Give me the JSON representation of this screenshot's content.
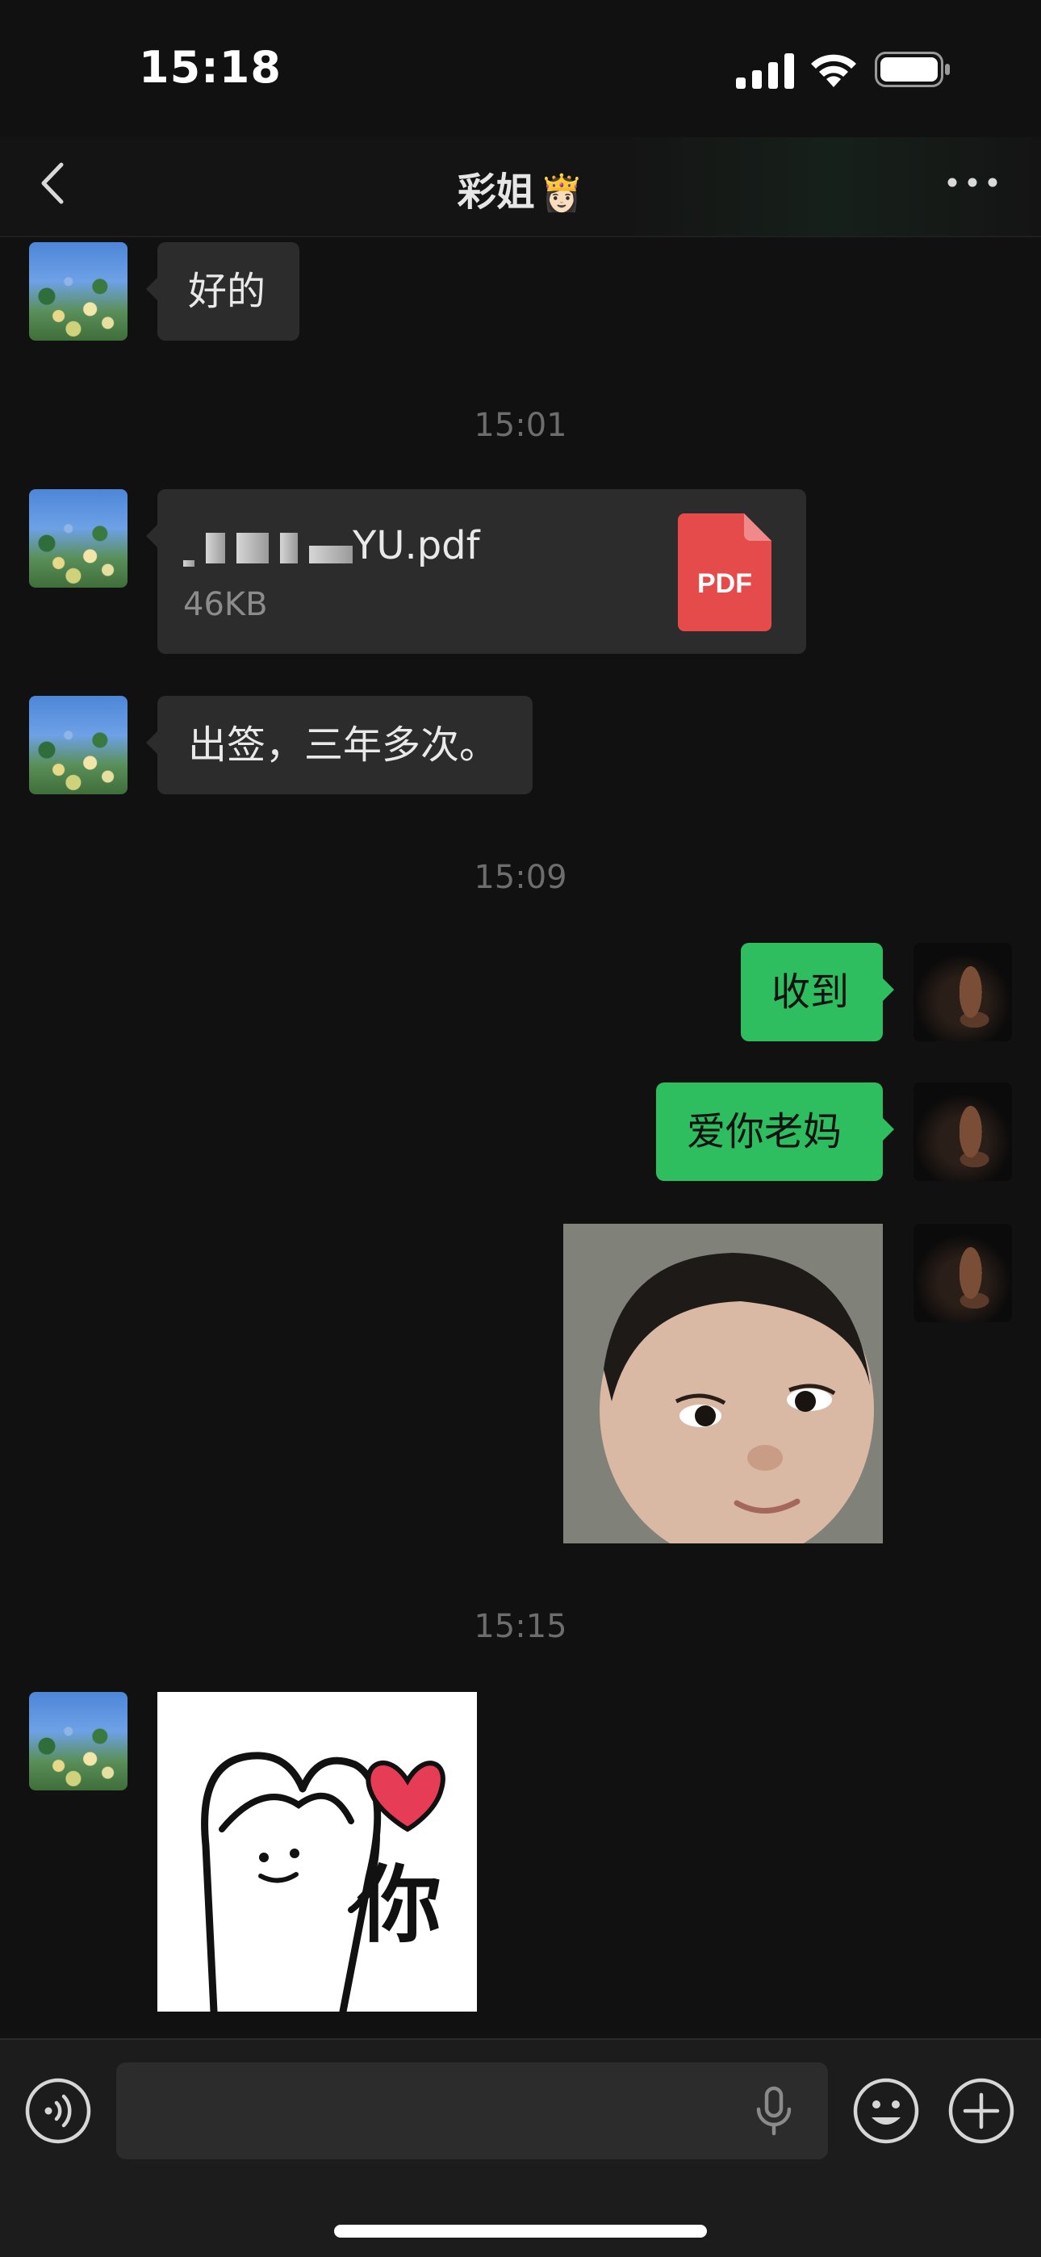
{
  "status_bar": {
    "time": "15:18"
  },
  "nav": {
    "title": "彩姐",
    "title_emoji": "👸🏻"
  },
  "messages": [
    {
      "type": "text",
      "direction": "incoming",
      "text": "好的"
    },
    {
      "type": "timestamp",
      "text": "15:01"
    },
    {
      "type": "file",
      "direction": "incoming",
      "file_name": "YU.pdf",
      "file_size": "46KB",
      "file_type_label": "PDF"
    },
    {
      "type": "text",
      "direction": "incoming",
      "text": "出签，三年多次。"
    },
    {
      "type": "timestamp",
      "text": "15:09"
    },
    {
      "type": "text",
      "direction": "outgoing",
      "text": "收到"
    },
    {
      "type": "text",
      "direction": "outgoing",
      "text": "爱你老妈"
    },
    {
      "type": "image",
      "direction": "outgoing"
    },
    {
      "type": "timestamp",
      "text": "15:15"
    },
    {
      "type": "sticker",
      "direction": "incoming",
      "sticker_text": "你"
    }
  ],
  "input_bar": {
    "placeholder": ""
  },
  "colors": {
    "background": "#111111",
    "incoming_bubble": "#2c2c2c",
    "outgoing_bubble": "#2ebd5f",
    "pdf_red": "#e54b4b",
    "timestamp": "#6d6d6d"
  },
  "icons": [
    "back-icon",
    "more-icon",
    "signal-icon",
    "wifi-icon",
    "battery-icon",
    "pdf-icon",
    "voice-toggle-icon",
    "mic-icon",
    "emoji-icon",
    "plus-icon"
  ]
}
